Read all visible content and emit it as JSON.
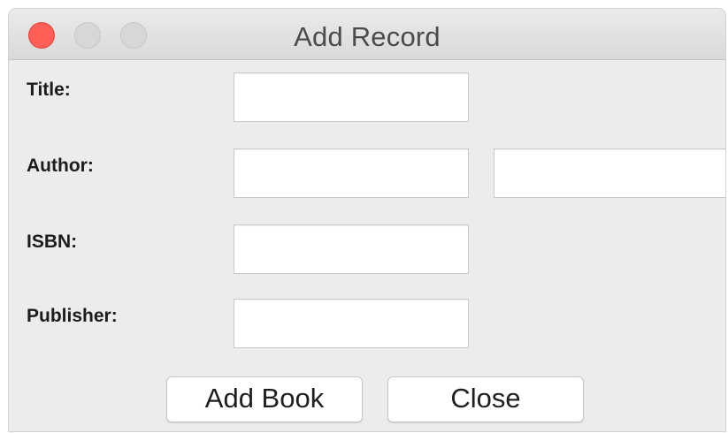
{
  "window": {
    "title": "Add Record"
  },
  "form": {
    "title_label": "Title:",
    "title_value": "",
    "author_label": "Author:",
    "author_first_value": "",
    "author_last_value": "",
    "isbn_label": "ISBN:",
    "isbn_value": "",
    "publisher_label": "Publisher:",
    "publisher_value": ""
  },
  "buttons": {
    "add_book_label": "Add Book",
    "close_label": "Close"
  },
  "colors": {
    "window_background": "#ececec",
    "close_dot": "#fe5f57",
    "inactive_dot": "#d7d7d7"
  }
}
